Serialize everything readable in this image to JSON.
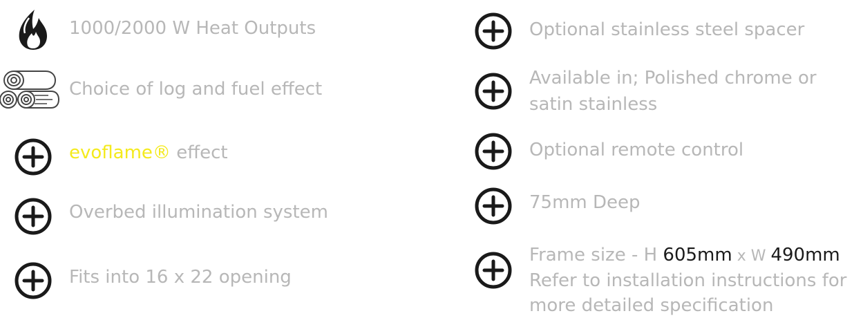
{
  "colors": {
    "text": "#b7b7b7",
    "icon": "#1a1a1a",
    "brand": "#f4ea1c",
    "highlight": "#1a1a1a"
  },
  "left_column": [
    {
      "icon": "flame-icon",
      "text": "1000/2000 W Heat Outputs"
    },
    {
      "icon": "logs-icon",
      "text": "Choice of log and fuel effect"
    },
    {
      "icon": "plus-circle-icon",
      "brand": "evoflame®",
      "text": " effect"
    },
    {
      "icon": "plus-circle-icon",
      "text": "Overbed illumination system"
    },
    {
      "icon": "plus-circle-icon",
      "text": "Fits into 16 x 22 opening"
    }
  ],
  "right_column": [
    {
      "icon": "plus-circle-icon",
      "text": "Optional stainless steel spacer"
    },
    {
      "icon": "plus-circle-icon",
      "line1": "Available in; Polished chrome or",
      "line2": "satin stainless"
    },
    {
      "icon": "plus-circle-icon",
      "text": "Optional remote control"
    },
    {
      "icon": "plus-circle-icon",
      "text": "75mm Deep"
    },
    {
      "icon": "plus-circle-icon",
      "frame_prefix": "Frame size - H ",
      "height_value": "605mm",
      "x_sep": " x W ",
      "width_value": "490mm",
      "line2": "Refer to installation instructions for",
      "line3": "more detailed specification"
    }
  ]
}
